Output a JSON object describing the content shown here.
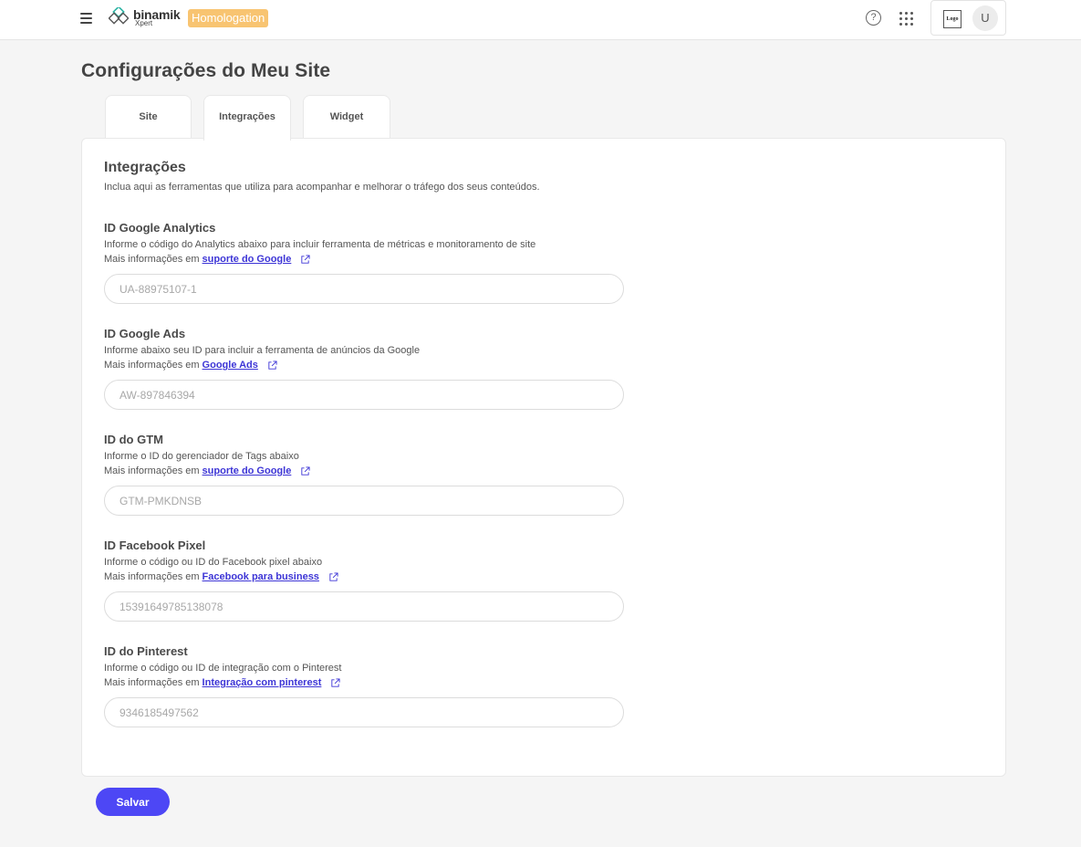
{
  "header": {
    "logo_name": "binamik",
    "logo_sub": "Xpert",
    "env_badge": "Homologation",
    "help_glyph": "?",
    "account_logo_text": "Logo",
    "avatar_initial": "U"
  },
  "page": {
    "title": "Configurações do Meu Site"
  },
  "tabs": [
    {
      "label": "Site",
      "active": false
    },
    {
      "label": "Integrações",
      "active": true
    },
    {
      "label": "Widget",
      "active": false
    }
  ],
  "section": {
    "title": "Integrações",
    "description": "Inclua aqui as ferramentas que utiliza para acompanhar e melhorar o tráfego dos seus conteúdos."
  },
  "more_prefix": "Mais informações em",
  "fields": [
    {
      "title": "ID Google Analytics",
      "description": "Informe o código do Analytics abaixo para incluir ferramenta de métricas e monitoramento de site",
      "link": "suporte do Google",
      "placeholder": "UA-88975107-1"
    },
    {
      "title": "ID Google Ads",
      "description": "Informe abaixo seu ID para incluir a ferramenta de anúncios da Google",
      "link": "Google Ads",
      "placeholder": "AW-897846394"
    },
    {
      "title": "ID do GTM",
      "description": "Informe o ID do gerenciador de Tags abaixo",
      "link": "suporte do Google",
      "placeholder": "GTM-PMKDNSB"
    },
    {
      "title": "ID Facebook Pixel",
      "description": "Informe o código ou ID do Facebook pixel abaixo",
      "link": "Facebook para business",
      "placeholder": "15391649785138078"
    },
    {
      "title": "ID do Pinterest",
      "description": "Informe o código ou ID de integração com o Pinterest",
      "link": "Integração com pinterest",
      "placeholder": "9346185497562"
    }
  ],
  "actions": {
    "save_label": "Salvar"
  },
  "colors": {
    "accent": "#4d47f5",
    "link": "#3d35d6",
    "badge": "#f8c471",
    "logo_teal": "#2bb3a3"
  },
  "icons": [
    "menu-icon",
    "binamik-logo-icon",
    "help-icon",
    "apps-grid-icon",
    "external-link-icon"
  ]
}
